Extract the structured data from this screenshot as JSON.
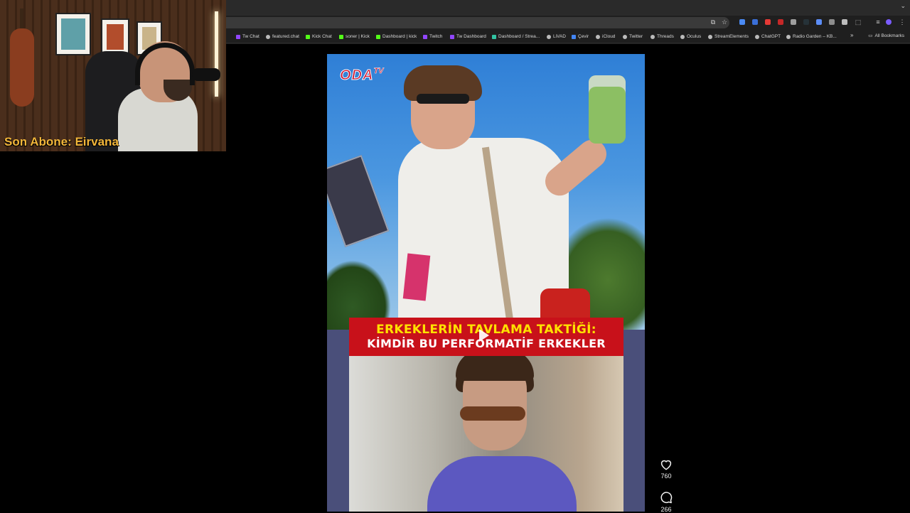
{
  "webcam": {
    "subscriber_text": "Son Abone: Eirvana"
  },
  "bookmarks": [
    {
      "label": "Tw Chat",
      "icon": "twitch-icon",
      "color": "#9146ff"
    },
    {
      "label": "featured.chat",
      "icon": "globe-icon",
      "color": "#bbbbbb"
    },
    {
      "label": "Kick Chat",
      "icon": "kick-icon",
      "color": "#53fc18"
    },
    {
      "label": "soner | Kick",
      "icon": "kick-icon",
      "color": "#53fc18"
    },
    {
      "label": "Dashboard | kick",
      "icon": "kick-icon",
      "color": "#53fc18"
    },
    {
      "label": "Twitch",
      "icon": "twitch-icon",
      "color": "#9146ff"
    },
    {
      "label": "Tw Dashboard",
      "icon": "twitch-icon",
      "color": "#9146ff"
    },
    {
      "label": "Dashboard / Strea...",
      "icon": "streamlabs-icon",
      "color": "#31c3a2"
    },
    {
      "label": "LiVAD",
      "icon": "globe-icon",
      "color": "#bbbbbb"
    },
    {
      "label": "Çevir",
      "icon": "translate-icon",
      "color": "#4285f4"
    },
    {
      "label": "iCloud",
      "icon": "apple-icon",
      "color": "#bbbbbb"
    },
    {
      "label": "Twitter",
      "icon": "globe-icon",
      "color": "#bbbbbb"
    },
    {
      "label": "Threads",
      "icon": "threads-icon",
      "color": "#bbbbbb"
    },
    {
      "label": "Oculus",
      "icon": "globe-icon",
      "color": "#bbbbbb"
    },
    {
      "label": "StreamElements",
      "icon": "globe-icon",
      "color": "#bbbbbb"
    },
    {
      "label": "ChatGPT",
      "icon": "chatgpt-icon",
      "color": "#bbbbbb"
    },
    {
      "label": "Radio Garden – KB...",
      "icon": "globe-icon",
      "color": "#bbbbbb"
    }
  ],
  "all_bookmarks_label": "All Bookmarks",
  "bookmarks_overflow": "»",
  "post": {
    "logo_main": "ODA",
    "logo_sub": "TV",
    "headline_line1": "ERKEKLERİN TAVLAMA TAKTİĞİ:",
    "headline_line2": "KİMDİR BU PERFORMATİF ERKEKLER"
  },
  "actions": {
    "likes": "760",
    "comments": "266"
  },
  "colors": {
    "headline_bg": "#c8111a",
    "headline_yellow": "#ffe100",
    "subscriber_text": "#f2b63a"
  }
}
